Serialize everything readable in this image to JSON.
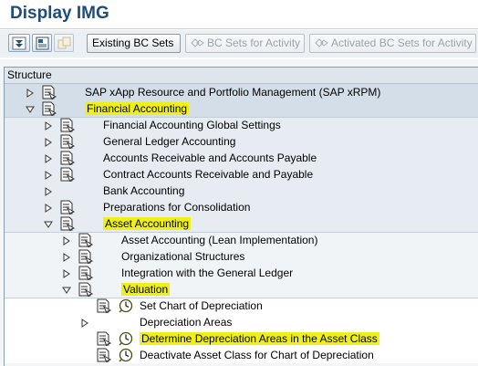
{
  "window": {
    "title": "Display IMG"
  },
  "toolbar": {
    "icons": [
      "expand-all-icon",
      "img-info-icon",
      "where-used-icon"
    ],
    "existing_bc_sets": "Existing BC Sets",
    "bc_sets_for_activity": "BC Sets for Activity",
    "activated_bc_sets_for_activity": "Activated BC Sets for Activity"
  },
  "tree": {
    "header": "Structure",
    "nodes": [
      {
        "label": "SAP xApp Resource and Portfolio Management (SAP xRPM)",
        "level": 0,
        "expanded": false,
        "icon": "document-icon",
        "highlight": false
      },
      {
        "label": "Financial Accounting",
        "level": 0,
        "expanded": true,
        "icon": "document-icon",
        "highlight": true
      },
      {
        "label": "Financial Accounting Global Settings",
        "level": 1,
        "expanded": false,
        "icon": "document-icon",
        "highlight": false
      },
      {
        "label": "General Ledger Accounting",
        "level": 1,
        "expanded": false,
        "icon": "document-icon",
        "highlight": false
      },
      {
        "label": "Accounts Receivable and Accounts Payable",
        "level": 1,
        "expanded": false,
        "icon": "document-icon",
        "highlight": false
      },
      {
        "label": "Contract Accounts Receivable and Payable",
        "level": 1,
        "expanded": false,
        "icon": "document-icon",
        "highlight": false
      },
      {
        "label": "Bank Accounting",
        "level": 1,
        "expanded": false,
        "icon": "none",
        "highlight": false
      },
      {
        "label": "Preparations for Consolidation",
        "level": 1,
        "expanded": false,
        "icon": "document-icon",
        "highlight": false
      },
      {
        "label": "Asset Accounting",
        "level": 1,
        "expanded": true,
        "icon": "document-icon",
        "highlight": true
      },
      {
        "label": "Asset Accounting (Lean Implementation)",
        "level": 2,
        "expanded": false,
        "icon": "document-icon",
        "highlight": false
      },
      {
        "label": "Organizational Structures",
        "level": 2,
        "expanded": false,
        "icon": "document-icon",
        "highlight": false
      },
      {
        "label": "Integration with the General Ledger",
        "level": 2,
        "expanded": false,
        "icon": "document-icon",
        "highlight": false
      },
      {
        "label": "Valuation",
        "level": 2,
        "expanded": true,
        "icon": "document-icon",
        "highlight": true
      },
      {
        "label": "Set Chart of Depreciation",
        "level": 3,
        "expanded": null,
        "icon": "execute-clock-icon",
        "highlight": false
      },
      {
        "label": "Depreciation Areas",
        "level": 3,
        "expanded": false,
        "icon": "none",
        "highlight": false
      },
      {
        "label": "Determine Depreciation Areas in the Asset Class",
        "level": 3,
        "expanded": null,
        "icon": "execute-clock-icon",
        "highlight": true
      },
      {
        "label": "Deactivate Asset Class for Chart of Depreciation",
        "level": 3,
        "expanded": null,
        "icon": "execute-clock-icon",
        "highlight": false
      }
    ]
  },
  "colors": {
    "highlight": "#f0f019",
    "title": "#1f4d78",
    "level0_bg": "#d3dee8",
    "level1_bg": "#e6ecf1",
    "level2_bg": "#f1f4f7"
  }
}
